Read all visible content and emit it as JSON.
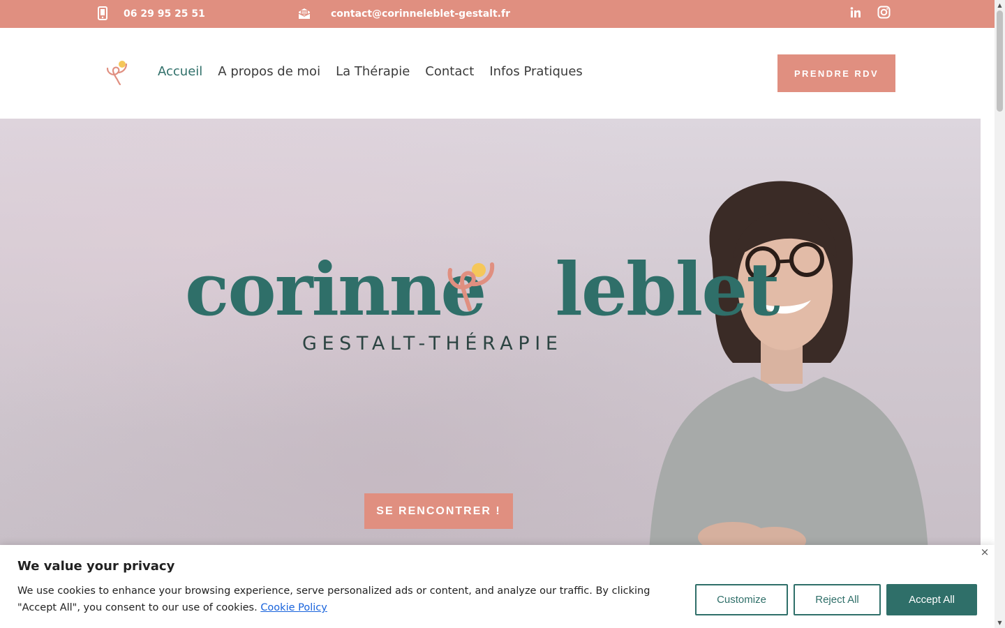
{
  "topbar": {
    "phone": "06 29 95 25 51",
    "email": "contact@corinneleblet-gestalt.fr",
    "icons": [
      "phone-icon",
      "mail-icon",
      "linkedin-icon",
      "instagram-icon"
    ]
  },
  "nav": {
    "items": [
      "Accueil",
      "A propos de moi",
      "La Thérapie",
      "Contact",
      "Infos Pratiques"
    ],
    "active": "Accueil",
    "cta": "PRENDRE RDV"
  },
  "hero": {
    "brand_first": "corinne",
    "brand_last": "leblet",
    "subtitle": "GESTALT-THÉRAPIE",
    "button": "SE RENCONTRER !"
  },
  "cookie": {
    "title": "We value your privacy",
    "text": "We use cookies to enhance your browsing experience, serve personalized ads or content, and analyze our traffic. By clicking \"Accept All\", you consent to our use of cookies.",
    "link": "Cookie Policy",
    "customize": "Customize",
    "reject": "Reject All",
    "accept": "Accept All",
    "close": "×"
  },
  "colors": {
    "accent": "#e08f80",
    "brand": "#2f6f69",
    "dot": "#f5c75a"
  }
}
